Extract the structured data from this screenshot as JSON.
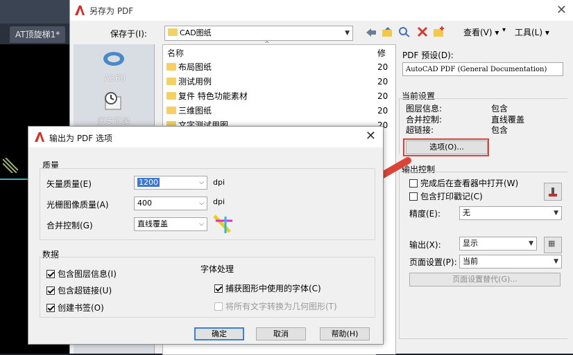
{
  "cad": {
    "drawing_tab": "AT顶旋梯1*"
  },
  "save_dialog": {
    "title": "另存为 PDF",
    "save_in_label": "保存于(I):",
    "save_in_value": "CAD图纸",
    "toolbar": {
      "view_label": "查看(V)",
      "tools_label": "工具(L)"
    },
    "places": [
      {
        "label": "A360"
      },
      {
        "label": "历史记录"
      }
    ],
    "columns": {
      "name": "名称",
      "modified": "修"
    },
    "files": [
      {
        "name": "布局图纸",
        "modified": "20"
      },
      {
        "name": "测试用例",
        "modified": "20"
      },
      {
        "name": "复件 特色功能素材",
        "modified": "20"
      },
      {
        "name": "三维图纸",
        "modified": "20"
      },
      {
        "name": "文字测试用图",
        "modified": "20"
      }
    ],
    "pdf_preset_label": "PDF 预设(D):",
    "pdf_preset_value": "AutoCAD PDF (General Documentation)",
    "current_settings_title": "当前设置",
    "current_settings": [
      {
        "key": "图层信息:",
        "value": "包含"
      },
      {
        "key": "合并控制:",
        "value": "直线覆盖"
      },
      {
        "key": "超链接:",
        "value": "包含"
      }
    ],
    "options_button_label": "选项(O)...",
    "output_control_title": "输出控制",
    "open_in_viewer_label": "完成后在查看器中打开(W)",
    "include_plot_stamp_label": "包含打印戳记(C)",
    "precision_label": "精度(E):",
    "precision_value": "无",
    "output_label": "输出(X):",
    "output_value": "显示",
    "page_setup_label": "页面设置(P):",
    "page_setup_value": "当前",
    "page_setup_override_label": "页面设置替代(G)..."
  },
  "options_dialog": {
    "title": "输出为 PDF 选项",
    "quality": {
      "title": "质量",
      "vector_label": "矢量质量(E)",
      "vector_value": "1200",
      "raster_label": "光栅图像质量(A)",
      "raster_value": "400",
      "unit": "dpi",
      "merge_label": "合并控制(G)",
      "merge_value": "直线覆盖"
    },
    "data": {
      "title": "数据",
      "include_layers_label": "包含图层信息(I)",
      "include_hyperlinks_label": "包含超链接(U)",
      "create_bookmarks_label": "创建书签(O)"
    },
    "fonts": {
      "title": "字体处理",
      "capture_fonts_label": "捕获图形中使用的字体(C)",
      "convert_text_label": "将所有文字转换为几何图形(T)"
    },
    "ok_label": "确定",
    "cancel_label": "取消",
    "help_label": "帮助(H)"
  },
  "colors": {
    "accent_red": "#d9443b",
    "autocad_red": "#d62e25"
  }
}
